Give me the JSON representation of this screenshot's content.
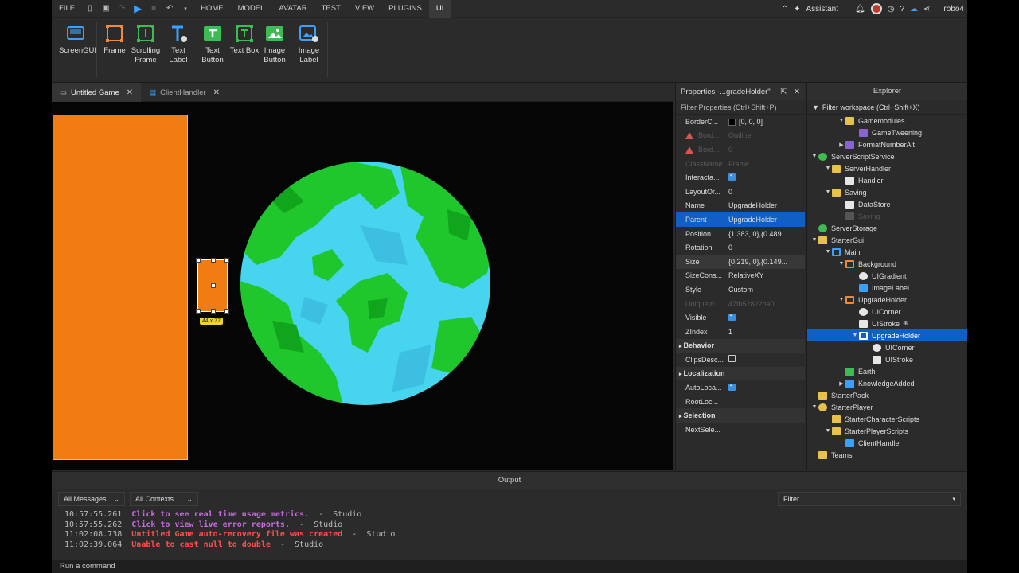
{
  "menubar": {
    "file": "FILE",
    "tabs": [
      "HOME",
      "MODEL",
      "AVATAR",
      "TEST",
      "VIEW",
      "PLUGINS",
      "UI"
    ],
    "active_tab": "UI",
    "assistant": "Assistant",
    "user": "robo4"
  },
  "ribbon": {
    "buttons": [
      {
        "label": "ScreenGUI",
        "icon": "screengui-icon",
        "color": "#3aa0ff"
      },
      {
        "label": "Frame",
        "icon": "frame-icon",
        "color": "#f08a3a"
      },
      {
        "label": "Scrolling Frame",
        "icon": "scrolling-frame-icon",
        "color": "#3dbb55"
      },
      {
        "label": "Text Label",
        "icon": "text-label-icon",
        "color": "#3aa0ff"
      },
      {
        "label": "Text Button",
        "icon": "text-button-icon",
        "color": "#3dbb55"
      },
      {
        "label": "Text Box",
        "icon": "text-box-icon",
        "color": "#3dbb55"
      },
      {
        "label": "Image Button",
        "icon": "image-button-icon",
        "color": "#3dbb55"
      },
      {
        "label": "Image Label",
        "icon": "image-label-icon",
        "color": "#3aa0ff"
      }
    ]
  },
  "doc_tabs": [
    {
      "label": "Untitled Game"
    },
    {
      "label": "ClientHandler"
    }
  ],
  "viewport": {
    "size_label": "44 x 77"
  },
  "properties": {
    "title": "Properties -...gradeHolder\"",
    "filter_placeholder": "Filter Properties (Ctrl+Shift+P)",
    "rows": [
      {
        "k": "BorderC...",
        "v": "[0, 0, 0]",
        "type": "color"
      },
      {
        "k": "Bord...",
        "v": "Outline",
        "type": "dim-warn"
      },
      {
        "k": "Bord...",
        "v": "0",
        "type": "dim-warn"
      },
      {
        "k": "ClassName",
        "v": "Frame",
        "type": "dim"
      },
      {
        "k": "Interacta...",
        "v": "",
        "type": "check"
      },
      {
        "k": "LayoutOr...",
        "v": "0",
        "type": "text"
      },
      {
        "k": "Name",
        "v": "UpgradeHolder",
        "type": "text"
      },
      {
        "k": "Parent",
        "v": "UpgradeHolder",
        "type": "hl"
      },
      {
        "k": "Position",
        "v": "{1.383, 0},{0.489...",
        "type": "text"
      },
      {
        "k": "Rotation",
        "v": "0",
        "type": "text"
      },
      {
        "k": "Size",
        "v": "{0.219, 0},{0.149...",
        "type": "hl2"
      },
      {
        "k": "SizeCons...",
        "v": "RelativeXY",
        "type": "text"
      },
      {
        "k": "Style",
        "v": "Custom",
        "type": "text"
      },
      {
        "k": "UniqueId",
        "v": "47fb52822ba0...",
        "type": "dim"
      },
      {
        "k": "Visible",
        "v": "",
        "type": "check"
      },
      {
        "k": "ZIndex",
        "v": "1",
        "type": "text"
      },
      {
        "k": "Behavior",
        "v": "",
        "type": "section"
      },
      {
        "k": "ClipsDesc...",
        "v": "",
        "type": "checkoff"
      },
      {
        "k": "Localization",
        "v": "",
        "type": "section"
      },
      {
        "k": "AutoLoca...",
        "v": "",
        "type": "check"
      },
      {
        "k": "RootLoc...",
        "v": "",
        "type": "text"
      },
      {
        "k": "Selection",
        "v": "",
        "type": "section"
      },
      {
        "k": "NextSele...",
        "v": "",
        "type": "text"
      }
    ]
  },
  "explorer": {
    "title": "Explorer",
    "filter_placeholder": "Filter workspace (Ctrl+Shift+X)",
    "items": [
      {
        "label": "Gamemodules",
        "depth": 2,
        "arrow": "down",
        "icon": "folder",
        "color": "#e8c14a"
      },
      {
        "label": "GameTweening",
        "depth": 3,
        "arrow": "",
        "icon": "module",
        "color": "#8a63d2"
      },
      {
        "label": "FormatNumberAlt",
        "depth": 2,
        "arrow": "right",
        "icon": "module",
        "color": "#8a63d2"
      },
      {
        "label": "ServerScriptService",
        "depth": 0,
        "arrow": "down",
        "icon": "service",
        "color": "#3dbb55"
      },
      {
        "label": "ServerHandler",
        "depth": 1,
        "arrow": "down",
        "icon": "folder",
        "color": "#e8c14a"
      },
      {
        "label": "Handler",
        "depth": 2,
        "arrow": "",
        "icon": "script",
        "color": "#e6e6e6"
      },
      {
        "label": "Saving",
        "depth": 1,
        "arrow": "down",
        "icon": "folder",
        "color": "#e8c14a"
      },
      {
        "label": "DataStore",
        "depth": 2,
        "arrow": "",
        "icon": "script",
        "color": "#e6e6e6"
      },
      {
        "label": "Saving",
        "depth": 2,
        "arrow": "",
        "icon": "script",
        "color": "#555555",
        "dim": true
      },
      {
        "label": "ServerStorage",
        "depth": 0,
        "arrow": "",
        "icon": "service",
        "color": "#3dbb55"
      },
      {
        "label": "StarterGui",
        "depth": 0,
        "arrow": "down",
        "icon": "folder",
        "color": "#e8c14a"
      },
      {
        "label": "Main",
        "depth": 1,
        "arrow": "down",
        "icon": "screengui",
        "color": "#3aa0ff"
      },
      {
        "label": "Background",
        "depth": 2,
        "arrow": "down",
        "icon": "frame",
        "color": "#f08a3a"
      },
      {
        "label": "UIGradient",
        "depth": 3,
        "arrow": "",
        "icon": "gradient",
        "color": "#e6e6e6"
      },
      {
        "label": "ImageLabel",
        "depth": 3,
        "arrow": "",
        "icon": "image",
        "color": "#3aa0ff"
      },
      {
        "label": "UpgradeHolder",
        "depth": 2,
        "arrow": "down",
        "icon": "frame",
        "color": "#f08a3a"
      },
      {
        "label": "UICorner",
        "depth": 3,
        "arrow": "",
        "icon": "corner",
        "color": "#e6e6e6"
      },
      {
        "label": "UIStroke",
        "depth": 3,
        "arrow": "",
        "icon": "stroke",
        "color": "#e6e6e6",
        "plus": true
      },
      {
        "label": "UpgradeHolder",
        "depth": 3,
        "arrow": "down",
        "icon": "frame",
        "color": "#ffffff",
        "selected": true
      },
      {
        "label": "UICorner",
        "depth": 4,
        "arrow": "",
        "icon": "corner",
        "color": "#e6e6e6"
      },
      {
        "label": "UIStroke",
        "depth": 4,
        "arrow": "",
        "icon": "stroke",
        "color": "#e6e6e6"
      },
      {
        "label": "Earth",
        "depth": 2,
        "arrow": "",
        "icon": "image",
        "color": "#3dbb55"
      },
      {
        "label": "KnowledgeAdded",
        "depth": 2,
        "arrow": "right",
        "icon": "text",
        "color": "#3aa0ff"
      },
      {
        "label": "StarterPack",
        "depth": 0,
        "arrow": "",
        "icon": "folder",
        "color": "#e8c14a"
      },
      {
        "label": "StarterPlayer",
        "depth": 0,
        "arrow": "down",
        "icon": "service",
        "color": "#e8c14a"
      },
      {
        "label": "StarterCharacterScripts",
        "depth": 1,
        "arrow": "",
        "icon": "folder",
        "color": "#e8c14a"
      },
      {
        "label": "StarterPlayerScripts",
        "depth": 1,
        "arrow": "down",
        "icon": "folder",
        "color": "#e8c14a"
      },
      {
        "label": "ClientHandler",
        "depth": 2,
        "arrow": "",
        "icon": "localscript",
        "color": "#3aa0ff"
      },
      {
        "label": "Teams",
        "depth": 0,
        "arrow": "",
        "icon": "folder",
        "color": "#e8c14a"
      }
    ]
  },
  "output": {
    "title": "Output",
    "messages_filter": "All Messages",
    "contexts_filter": "All Contexts",
    "filter_placeholder": "Filter...",
    "logs": [
      {
        "time": "10:57:55.261",
        "msg": "Click to see real time usage metrics.",
        "src": "Studio",
        "kind": "m1"
      },
      {
        "time": "10:57:55.262",
        "msg": "Click to view live error reports.",
        "src": "Studio",
        "kind": "m1"
      },
      {
        "time": "11:02:08.738",
        "msg": "Untitled Game auto-recovery file was created",
        "src": "Studio",
        "kind": "m2"
      },
      {
        "time": "11:02:39.064",
        "msg": "Unable to cast null to double",
        "src": "Studio",
        "kind": "m2"
      }
    ],
    "separator": "-",
    "command_placeholder": "Run a command"
  }
}
